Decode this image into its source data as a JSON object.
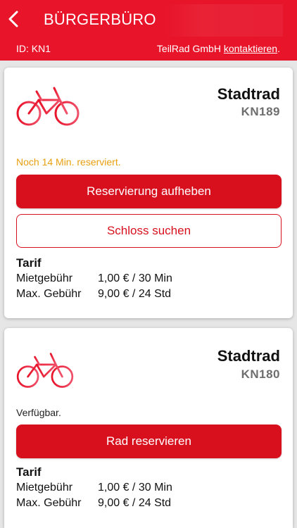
{
  "header": {
    "title": "BÜRGERBÜRO",
    "id_label": "ID: KN1",
    "provider": "TeilRad GmbH",
    "contact_link": "kontaktieren",
    "contact_suffix": "."
  },
  "colors": {
    "brand_red": "#e8142a",
    "button_red": "#d8101e",
    "reserved_status": "#e8a010",
    "id_gray": "#6e6e6e"
  },
  "bikes": [
    {
      "icon": "bicycle-icon",
      "name": "Stadtrad",
      "id": "KN189",
      "status": "Noch 14 Min. reserviert.",
      "primary_button": "Reservierung aufheben",
      "secondary_button": "Schloss suchen",
      "tarif": {
        "title": "Tarif",
        "rows": [
          {
            "label": "Mietgebühr",
            "value": "1,00 € / 30 Min"
          },
          {
            "label": "Max. Gebühr",
            "value": "9,00 € / 24 Std"
          }
        ]
      }
    },
    {
      "icon": "bicycle-icon",
      "name": "Stadtrad",
      "id": "KN180",
      "status": "Verfügbar.",
      "primary_button": "Rad reservieren",
      "tarif": {
        "title": "Tarif",
        "rows": [
          {
            "label": "Mietgebühr",
            "value": "1,00 € / 30 Min"
          },
          {
            "label": "Max. Gebühr",
            "value": "9,00 € / 24 Std"
          }
        ]
      }
    }
  ]
}
